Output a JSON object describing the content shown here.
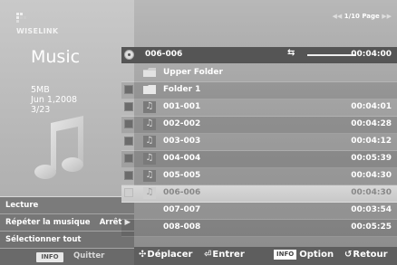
{
  "brand": {
    "name": "WISELINK"
  },
  "category": {
    "title": "Music"
  },
  "meta": {
    "size": "5MB",
    "date": "Jun 1,2008",
    "index": "3/23"
  },
  "page_indicator": "1/10 Page",
  "now_playing": {
    "title": "006-006",
    "time": "00:04:00"
  },
  "rows": [
    {
      "type": "folder",
      "label": "Upper Folder",
      "duration": ""
    },
    {
      "type": "folder",
      "label": "Folder 1",
      "duration": ""
    },
    {
      "type": "music",
      "label": "001-001",
      "duration": "00:04:01"
    },
    {
      "type": "music",
      "label": "002-002",
      "duration": "00:04:28"
    },
    {
      "type": "music",
      "label": "003-003",
      "duration": "00:04:12"
    },
    {
      "type": "music",
      "label": "004-004",
      "duration": "00:05:39"
    },
    {
      "type": "music",
      "label": "005-005",
      "duration": "00:04:30"
    },
    {
      "type": "music",
      "label": "006-006",
      "duration": "00:04:30"
    },
    {
      "type": "music",
      "label": "007-007",
      "duration": "00:03:54"
    },
    {
      "type": "music",
      "label": "008-008",
      "duration": "00:05:25"
    }
  ],
  "side_menu": {
    "play": "Lecture",
    "repeat": "Répéter la musique",
    "repeat_value": "Arrêt ▶",
    "select_all": "Sélectionner tout",
    "info_tag": "INFO",
    "quit": "Quitter"
  },
  "help_bar": {
    "move_symbol": "✣",
    "move": "Déplacer",
    "enter_symbol": "⏎",
    "enter": "Entrer",
    "info_tag": "INFO",
    "option": "Option",
    "return_symbol": "↺",
    "return": "Retour"
  }
}
